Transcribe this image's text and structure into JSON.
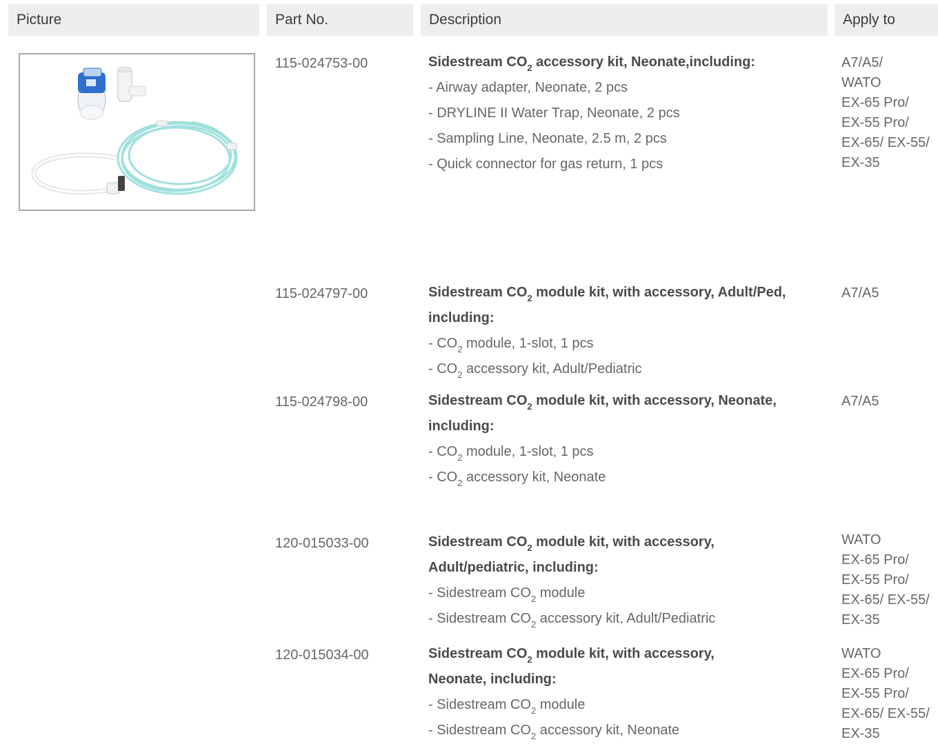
{
  "headers": {
    "picture": "Picture",
    "part_no": "Part No.",
    "description": "Description",
    "apply_to": "Apply to"
  },
  "rows": [
    {
      "part_no": "115-024753-00",
      "title_a": "Sidestream CO",
      "title_b": " accessory kit, Neonate,including:",
      "items": [
        "- Airway adapter, Neonate, 2 pcs",
        "- DRYLINE II Water Trap, Neonate, 2 pcs",
        "- Sampling Line, Neonate, 2.5 m, 2 pcs",
        "- Quick connector for gas return, 1 pcs"
      ],
      "apply": [
        "A7/A5/",
        "WATO",
        "EX-65 Pro/",
        "EX-55 Pro/",
        "EX-65/ EX-55/",
        "EX-35"
      ]
    },
    {
      "part_no": "115-024797-00",
      "title_a": "Sidestream CO",
      "title_b": " module kit, with accessory, Adult/Ped,",
      "title_line2": "including:",
      "items": [
        {
          "a": "- CO",
          "b": " module,  1-slot, 1 pcs"
        },
        {
          "a": "- CO",
          "b": " accessory kit,  Adult/Pediatric"
        }
      ],
      "apply": [
        "A7/A5"
      ]
    },
    {
      "part_no": "115-024798-00",
      "title_a": "Sidestream CO",
      "title_b": " module kit, with accessory, Neonate,",
      "title_line2": "including:",
      "items": [
        {
          "a": "- CO",
          "b": " module, 1-slot, 1 pcs"
        },
        {
          "a": "- CO",
          "b": " accessory kit, Neonate"
        }
      ],
      "apply": [
        "A7/A5"
      ]
    },
    {
      "part_no": "120-015033-00",
      "title_a": "Sidestream CO",
      "title_b": " module kit, with accessory,",
      "title_line2": "Adult/pediatric, including:",
      "items": [
        {
          "a": "- Sidestream CO",
          "b": " module"
        },
        {
          "a": "- Sidestream CO",
          "b": " accessory kit, Adult/Pediatric"
        }
      ],
      "apply": [
        "WATO",
        "EX-65 Pro/",
        "EX-55 Pro/",
        "EX-65/ EX-55/",
        "EX-35"
      ]
    },
    {
      "part_no": "120-015034-00",
      "title_a": "Sidestream CO",
      "title_b": " module kit, with accessory,",
      "title_line2": "Neonate, including:",
      "items": [
        {
          "a": "- Sidestream CO",
          "b": " module"
        },
        {
          "a": "- Sidestream CO",
          "b": " accessory kit, Neonate"
        }
      ],
      "apply": [
        "WATO",
        "EX-65 Pro/",
        "EX-55 Pro/",
        "EX-65/ EX-55/",
        "EX-35"
      ]
    }
  ],
  "subscript": "2",
  "colors": {
    "header_bg": "#eeeeee",
    "text": "#666666",
    "title": "#4a4a4a",
    "image_border": "#a8a8a8",
    "tube_teal": "#9fe0dc",
    "trap_blue": "#2f6fd0"
  },
  "picture_icons": [
    "water-trap-icon",
    "airway-adapter-icon",
    "sampling-line-icon",
    "connector-tube-icon"
  ]
}
